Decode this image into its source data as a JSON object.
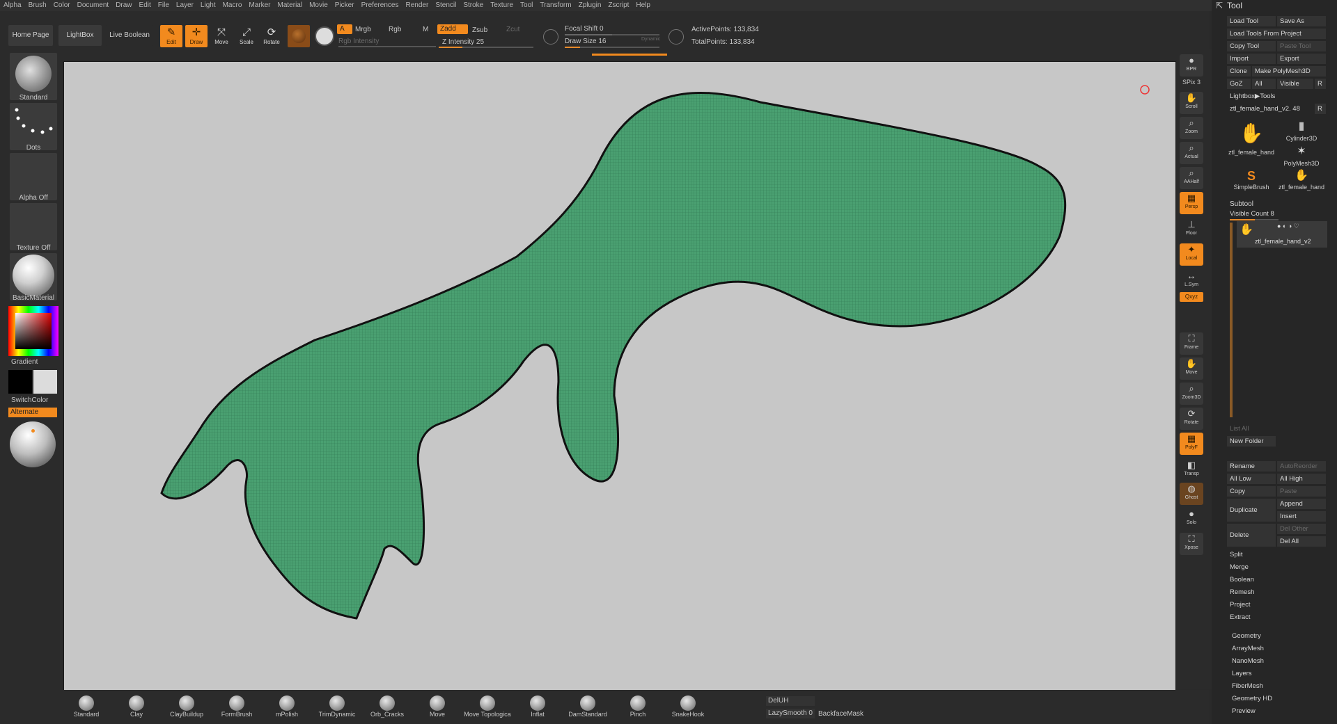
{
  "menu": [
    "Alpha",
    "Brush",
    "Color",
    "Document",
    "Draw",
    "Edit",
    "File",
    "Layer",
    "Light",
    "Macro",
    "Marker",
    "Material",
    "Movie",
    "Picker",
    "Preferences",
    "Render",
    "Stencil",
    "Stroke",
    "Texture",
    "Tool",
    "Transform",
    "Zplugin",
    "Zscript",
    "Help"
  ],
  "shelf": {
    "home": "Home Page",
    "lightbox": "LightBox",
    "live_boolean": "Live Boolean",
    "edit": "Edit",
    "draw": "Draw",
    "move": "Move",
    "scale": "Scale",
    "rotate": "Rotate",
    "a": "A",
    "mrgb": "Mrgb",
    "rgb": "Rgb",
    "m": "M",
    "rgb_intensity": "Rgb Intensity",
    "zadd": "Zadd",
    "zsub": "Zsub",
    "zcut": "Zcut",
    "z_intensity": "Z Intensity 25",
    "focal_shift": "Focal Shift 0",
    "draw_size": "Draw Size 16",
    "dynamic": "Dynamic",
    "active_points": "ActivePoints: 133,834",
    "total_points": "TotalPoints: 133,834"
  },
  "left": {
    "standard": "Standard",
    "dots": "Dots",
    "alpha_off": "Alpha Off",
    "texture_off": "Texture Off",
    "basic_material": "BasicMaterial",
    "gradient": "Gradient",
    "switch_color": "SwitchColor",
    "alternate": "Alternate"
  },
  "right": {
    "bpr": "BPR",
    "spix": "SPix 3",
    "scroll": "Scroll",
    "zoom": "Zoom",
    "actual": "Actual",
    "aahalf": "AAHalf",
    "persp": "Persp",
    "floor": "Floor",
    "local": "Local",
    "lsym": "L.Sym",
    "xyz": "Qxyz",
    "frame": "Frame",
    "move": "Move",
    "zoom3d": "Zoom3D",
    "rotate": "Rotate",
    "polyf": "PolyF",
    "transp": "Transp",
    "ghost": "Ghost",
    "solo": "Solo",
    "xpose": "Xpose"
  },
  "bottom": {
    "brushes": [
      "Standard",
      "Clay",
      "ClayBuildup",
      "FormBrush",
      "mPolish",
      "TrimDynamic",
      "Orb_Cracks",
      "Move",
      "Move Topologica",
      "Inflat",
      "DamStandard",
      "Pinch",
      "SnakeHook"
    ],
    "deluh": "DelUH",
    "lazysmooth": "LazySmooth 0",
    "backface": "BackfaceMask"
  },
  "tool": {
    "title": "Tool",
    "load_tool": "Load Tool",
    "save_as": "Save As",
    "load_from_project": "Load Tools From Project",
    "copy_tool": "Copy Tool",
    "paste_tool": "Paste Tool",
    "import": "Import",
    "export": "Export",
    "clone": "Clone",
    "make_polymesh": "Make PolyMesh3D",
    "goz": "GoZ",
    "all": "All",
    "visible": "Visible",
    "r": "R",
    "lightbox_tools": "Lightbox▶Tools",
    "current_tool": "ztl_female_hand_v2. 48",
    "thumbs": [
      "ztl_female_hand",
      "Cylinder3D",
      "PolyMesh3D",
      "SimpleBrush",
      "ztl_female_hand"
    ],
    "subtool": "Subtool",
    "visible_count": "Visible Count 8",
    "subtool_item": "ztl_female_hand_v2",
    "list_all": "List All",
    "new_folder": "New Folder",
    "rename": "Rename",
    "autoreorder": "AutoReorder",
    "all_low": "All Low",
    "all_high": "All High",
    "copy": "Copy",
    "paste": "Paste",
    "duplicate": "Duplicate",
    "append": "Append",
    "insert": "Insert",
    "delete": "Delete",
    "del_other": "Del Other",
    "del_all": "Del All",
    "split": "Split",
    "merge": "Merge",
    "boolean": "Boolean",
    "remesh": "Remesh",
    "project": "Project",
    "extract": "Extract",
    "sections": [
      "Geometry",
      "ArrayMesh",
      "NanoMesh",
      "Layers",
      "FiberMesh",
      "Geometry HD",
      "Preview"
    ]
  }
}
